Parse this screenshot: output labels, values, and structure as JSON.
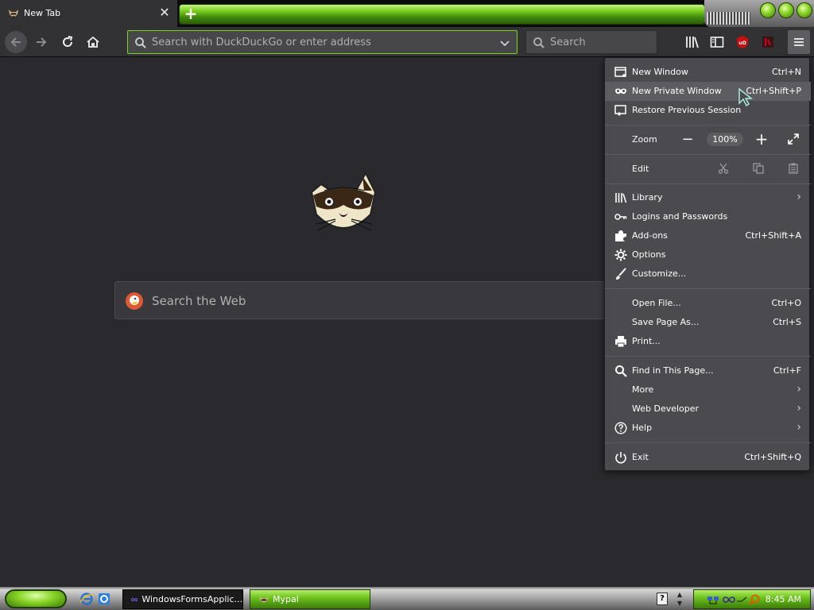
{
  "tab": {
    "title": "New Tab",
    "close_symbol": "✕",
    "new_tab_symbol": "+"
  },
  "toolbar": {
    "url_placeholder": "Search with DuckDuckGo or enter address",
    "search_placeholder": "Search"
  },
  "newtab": {
    "search_label": "Search the Web"
  },
  "menu": {
    "items_top": [
      {
        "label": "New Window",
        "key": "Ctrl+N"
      },
      {
        "label": "New Private Window",
        "key": "Ctrl+Shift+P"
      },
      {
        "label": "Restore Previous Session",
        "key": ""
      }
    ],
    "zoom": {
      "label": "Zoom",
      "value": "100%",
      "minus": "−",
      "plus": "+"
    },
    "edit": {
      "label": "Edit"
    },
    "library": {
      "label": "Library"
    },
    "logins": {
      "label": "Logins and Passwords"
    },
    "addons": {
      "label": "Add-ons",
      "key": "Ctrl+Shift+A"
    },
    "options": {
      "label": "Options"
    },
    "customize": {
      "label": "Customize..."
    },
    "open_file": {
      "label": "Open File...",
      "key": "Ctrl+O"
    },
    "save_page": {
      "label": "Save Page As...",
      "key": "Ctrl+S"
    },
    "print": {
      "label": "Print..."
    },
    "find": {
      "label": "Find in This Page...",
      "key": "Ctrl+F"
    },
    "more": {
      "label": "More"
    },
    "web_dev": {
      "label": "Web Developer"
    },
    "help": {
      "label": "Help"
    },
    "exit": {
      "label": "Exit",
      "key": "Ctrl+Shift+Q"
    },
    "arrow": "›"
  },
  "taskbar": {
    "tasks": [
      {
        "label": "WindowsFormsApplic..."
      },
      {
        "label": "Mypal"
      }
    ],
    "help_symbol": "?",
    "clock": "8:45 AM"
  },
  "colors": {
    "accent_green": "#7ed321",
    "toolbar_bg": "#323234",
    "content_bg": "#2a2a2e",
    "menu_bg": "#4a4a4f",
    "ublock_red": "#c51111"
  },
  "icons": {
    "tab": "raccoon-icon",
    "url_search": "magnifier-icon",
    "library": "library-icon",
    "sidebar": "sidebar-icon",
    "ublock": "ublock-origin-icon",
    "lastpass": "lastpass-icon",
    "menu": "hamburger-icon"
  }
}
